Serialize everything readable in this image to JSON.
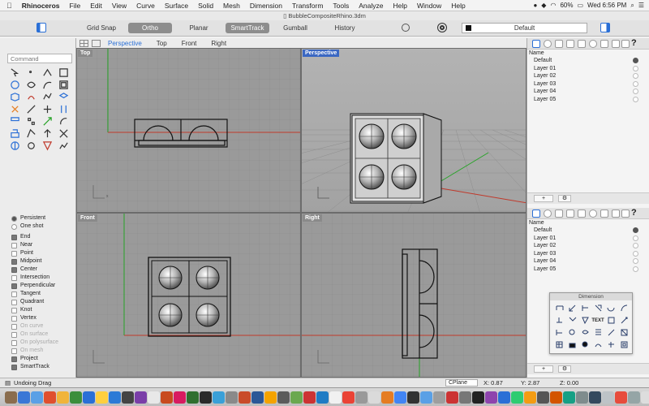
{
  "menubar": {
    "apple": "",
    "app_name": "Rhinoceros",
    "items": [
      "File",
      "Edit",
      "View",
      "Curve",
      "Surface",
      "Solid",
      "Mesh",
      "Dimension",
      "Transform",
      "Tools",
      "Analyze",
      "Help",
      "Window",
      "Help"
    ],
    "battery": "60%",
    "clock": "Wed 6:56 PM"
  },
  "window": {
    "title": "BubbleCompositeRhino.3dm"
  },
  "toolbar": {
    "grid_snap": "Grid Snap",
    "ortho": "Ortho",
    "planar": "Planar",
    "smarttrack": "SmartTrack",
    "gumball": "Gumball",
    "history": "History",
    "current_layer": "Default"
  },
  "command": {
    "placeholder": "Command"
  },
  "viewport_tabs": [
    "Perspective",
    "Top",
    "Front",
    "Right"
  ],
  "viewports": {
    "top": "Top",
    "perspective": "Perspective",
    "front": "Front",
    "right": "Right"
  },
  "osnap": {
    "persistent": "Persistent",
    "one_shot": "One shot",
    "items": [
      {
        "label": "End",
        "checked": true,
        "enabled": true
      },
      {
        "label": "Near",
        "checked": false,
        "enabled": true
      },
      {
        "label": "Point",
        "checked": false,
        "enabled": true
      },
      {
        "label": "Midpoint",
        "checked": true,
        "enabled": true
      },
      {
        "label": "Center",
        "checked": true,
        "enabled": true
      },
      {
        "label": "Intersection",
        "checked": false,
        "enabled": true
      },
      {
        "label": "Perpendicular",
        "checked": true,
        "enabled": true
      },
      {
        "label": "Tangent",
        "checked": false,
        "enabled": true
      },
      {
        "label": "Quadrant",
        "checked": false,
        "enabled": true
      },
      {
        "label": "Knot",
        "checked": false,
        "enabled": true
      },
      {
        "label": "Vertex",
        "checked": false,
        "enabled": true
      },
      {
        "label": "On curve",
        "checked": false,
        "enabled": false
      },
      {
        "label": "On surface",
        "checked": false,
        "enabled": false
      },
      {
        "label": "On polysurface",
        "checked": false,
        "enabled": false
      },
      {
        "label": "On mesh",
        "checked": false,
        "enabled": false
      },
      {
        "label": "Project",
        "checked": true,
        "enabled": true
      },
      {
        "label": "SmartTrack",
        "checked": true,
        "enabled": true
      }
    ]
  },
  "layers_top": {
    "header": "Name",
    "items": [
      "Default",
      "Layer 01",
      "Layer 02",
      "Layer 03",
      "Layer 04",
      "Layer 05"
    ]
  },
  "layers_bottom": {
    "header": "Name",
    "items": [
      "Default",
      "Layer 01",
      "Layer 02",
      "Layer 03",
      "Layer 04",
      "Layer 05"
    ]
  },
  "dimension_palette": {
    "title": "Dimension",
    "text_tool": "TEXT"
  },
  "status": {
    "message": "Undoing Drag",
    "cplane": "CPlane",
    "x": "X: 0.87",
    "y": "Y: 2.87",
    "z": "Z: 0.00"
  },
  "colors": {
    "x_axis": "#c0392b",
    "y_axis": "#27a327",
    "active_tab": "#2a6fd6",
    "viewport_bg": "#9a9a9a"
  }
}
